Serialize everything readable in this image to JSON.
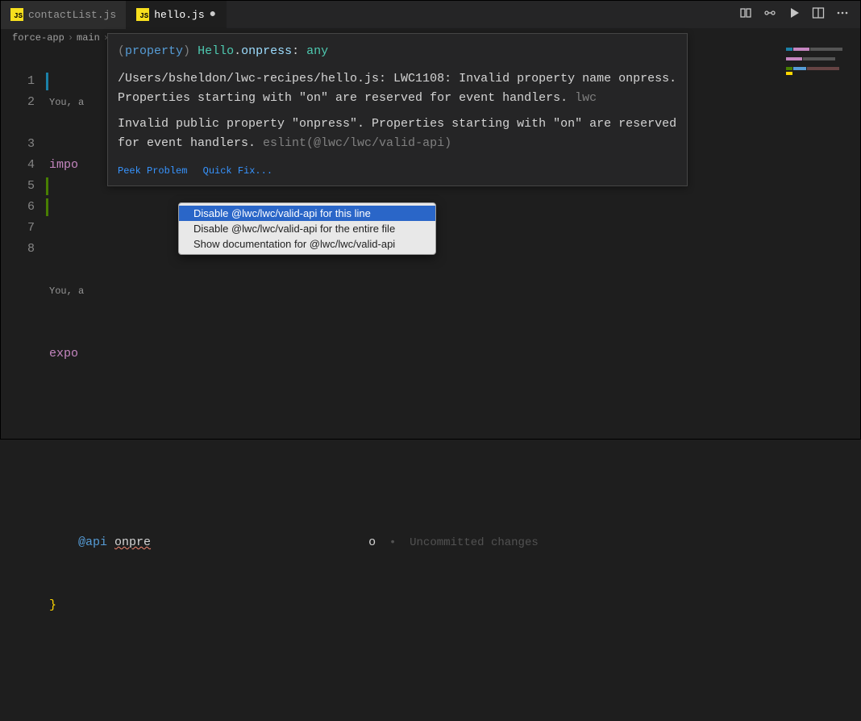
{
  "tabs": {
    "items": [
      {
        "label": "contactList.js",
        "active": false
      },
      {
        "label": "hello.js",
        "active": true,
        "dirty": true
      }
    ]
  },
  "breadcrumbs": {
    "parts": [
      "force-app",
      "main"
    ]
  },
  "code": {
    "lens1": "You, a",
    "line1_kw": "impo",
    "lens2": "You, a",
    "line3_kw": "expo",
    "line6_dec": "@api",
    "line6_prop": "onpre",
    "line6_gitlens": "  •  Uncommitted changes",
    "line7_brace": "}",
    "cut_text": "o"
  },
  "hover": {
    "sig_paren_l": "(",
    "sig_kw": "property",
    "sig_paren_r": ")",
    "sig_sp": " ",
    "sig_type": "Hello",
    "sig_dot": ".",
    "sig_prop": "onpress",
    "sig_colon": ": ",
    "sig_prim": "any",
    "err1_path": "/Users/bsheldon/lwc-recipes/hello.js: LWC1108: Invalid property name onpress. Properties starting with \"on\" are reserved for event handlers.",
    "err1_src": " lwc",
    "err2_text": "Invalid public property \"onpress\". Properties starting with \"on\" are reserved for event handlers.",
    "err2_rule": " eslint(@lwc/lwc/valid-api)",
    "links": {
      "peek": "Peek Problem",
      "quickfix": "Quick Fix..."
    }
  },
  "quickfix": {
    "items": [
      "Disable @lwc/lwc/valid-api for this line",
      "Disable @lwc/lwc/valid-api for the entire file",
      "Show documentation for @lwc/lwc/valid-api"
    ]
  }
}
